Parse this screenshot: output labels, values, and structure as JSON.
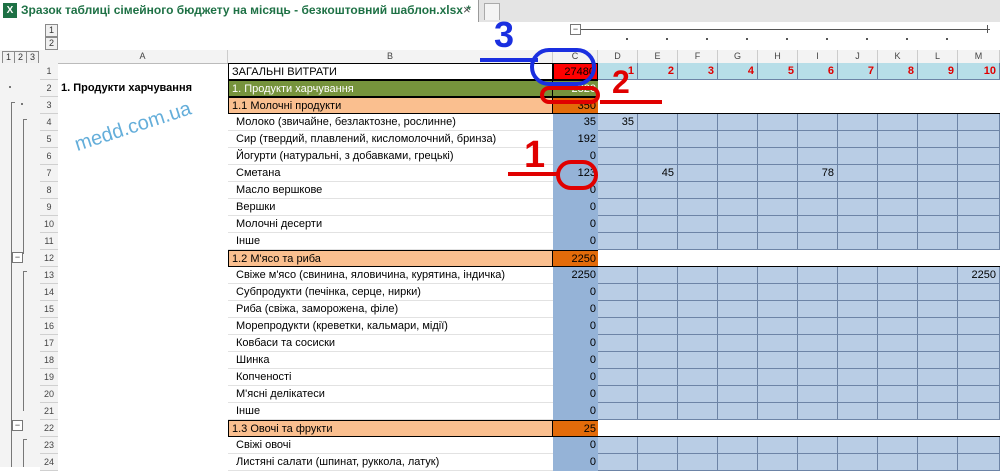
{
  "window": {
    "title": "Зразок таблиці сімейного бюджету на місяць - безкоштовний шаблон.xlsx *",
    "close": "×",
    "icon": "X"
  },
  "outline": {
    "levels": [
      "1",
      "2",
      "3"
    ],
    "col_levels": [
      "1",
      "2"
    ],
    "collapse": "−"
  },
  "columns": [
    "A",
    "B",
    "C",
    "D",
    "E",
    "F",
    "G",
    "H",
    "I",
    "J",
    "K",
    "L",
    "M"
  ],
  "watermark": "medd.com.ua",
  "annotations": [
    "1",
    "2",
    "3"
  ],
  "header_row": {
    "title": "ЗАГАЛЬНІ ВИТРАТИ",
    "total": "27480",
    "days": [
      "1",
      "2",
      "3",
      "4",
      "5",
      "6",
      "7",
      "8",
      "9",
      "10"
    ]
  },
  "rows": [
    {
      "num": "2",
      "a": "1. Продукти харчування",
      "b": "1. Продукти харчування",
      "c": "2820",
      "style": "cat"
    },
    {
      "num": "3",
      "a": "",
      "b": "1.1 Молочні продукти",
      "c": "350",
      "style": "sub"
    },
    {
      "num": "4",
      "a": "",
      "b": "Молоко (звичайне, безлактозне, рослинне)",
      "c": "35",
      "style": "item",
      "d": {
        "D": "35"
      }
    },
    {
      "num": "5",
      "a": "",
      "b": "Сир (твердий, плавлений, кисломолочний, бринза)",
      "c": "192",
      "style": "item"
    },
    {
      "num": "6",
      "a": "",
      "b": "Йогурти (натуральні, з добавками, грецькі)",
      "c": "0",
      "style": "item"
    },
    {
      "num": "7",
      "a": "",
      "b": "Сметана",
      "c": "123",
      "style": "item",
      "d": {
        "E": "45",
        "I": "78"
      }
    },
    {
      "num": "8",
      "a": "",
      "b": "Масло вершкове",
      "c": "0",
      "style": "item"
    },
    {
      "num": "9",
      "a": "",
      "b": "Вершки",
      "c": "0",
      "style": "item"
    },
    {
      "num": "10",
      "a": "",
      "b": "Молочні десерти",
      "c": "0",
      "style": "item"
    },
    {
      "num": "11",
      "a": "",
      "b": "Інше",
      "c": "0",
      "style": "item"
    },
    {
      "num": "12",
      "a": "",
      "b": "1.2 М'ясо та риба",
      "c": "2250",
      "style": "sub"
    },
    {
      "num": "13",
      "a": "",
      "b": "Свіже м'ясо (свинина, яловичина, курятина, індичка)",
      "c": "2250",
      "style": "item",
      "d": {
        "M": "2250"
      }
    },
    {
      "num": "14",
      "a": "",
      "b": "Субпродукти (печінка, серце, нирки)",
      "c": "0",
      "style": "item"
    },
    {
      "num": "15",
      "a": "",
      "b": "Риба (свіжа, заморожена, філе)",
      "c": "0",
      "style": "item"
    },
    {
      "num": "16",
      "a": "",
      "b": "Морепродукти (креветки, кальмари, мідії)",
      "c": "0",
      "style": "item"
    },
    {
      "num": "17",
      "a": "",
      "b": "Ковбаси та сосиски",
      "c": "0",
      "style": "item"
    },
    {
      "num": "18",
      "a": "",
      "b": "Шинка",
      "c": "0",
      "style": "item"
    },
    {
      "num": "19",
      "a": "",
      "b": "Копченості",
      "c": "0",
      "style": "item"
    },
    {
      "num": "20",
      "a": "",
      "b": "М'ясні делікатеси",
      "c": "0",
      "style": "item"
    },
    {
      "num": "21",
      "a": "",
      "b": "Інше",
      "c": "0",
      "style": "item"
    },
    {
      "num": "22",
      "a": "",
      "b": "1.3 Овочі та фрукти",
      "c": "25",
      "style": "sub"
    },
    {
      "num": "23",
      "a": "",
      "b": "Свіжі овочі",
      "c": "0",
      "style": "item"
    },
    {
      "num": "24",
      "a": "",
      "b": "Листяні салати (шпинат, руккола, латук)",
      "c": "0",
      "style": "item"
    }
  ],
  "colors": {
    "green": "#76933c",
    "orange": "#fabf8f",
    "darkorange": "#e26b0a",
    "blue": "#95b3d7",
    "lightblue": "#b9cde5",
    "red": "#ff0000",
    "header_cyan": "#b7dee8"
  }
}
